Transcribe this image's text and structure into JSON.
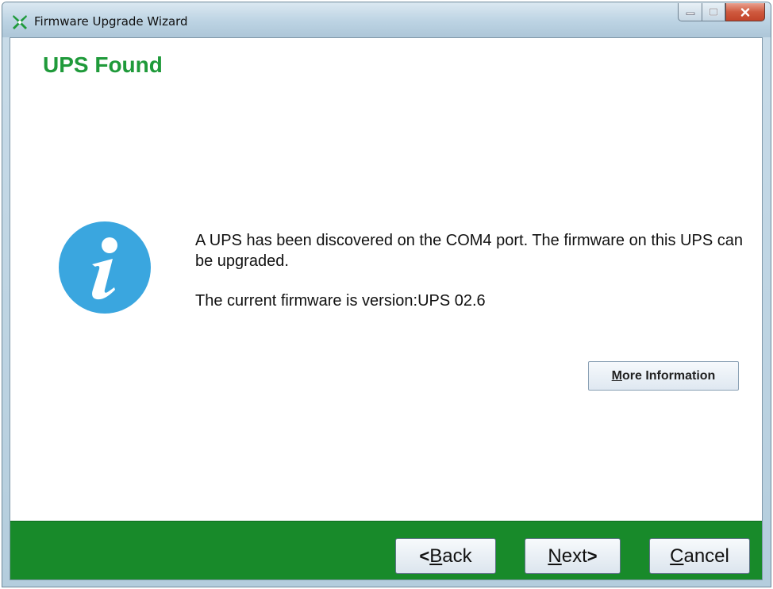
{
  "window": {
    "title": "Firmware Upgrade Wizard",
    "caption_buttons": [
      "minimize-icon",
      "maximize-icon",
      "close-icon"
    ]
  },
  "page": {
    "title": "UPS Found",
    "icon": "info-icon",
    "message_line1": "A UPS has been discovered on the COM4 port. The firmware on this UPS can be upgraded.",
    "message_line2": "The current firmware is version:UPS 02.6",
    "more_info_button": {
      "mnemonic": "M",
      "label_rest": "ore Information"
    }
  },
  "footer": {
    "back_button": {
      "arrow": "<",
      "mnemonic": "B",
      "label_rest": "ack"
    },
    "next_button": {
      "mnemonic": "N",
      "label_rest": "ext",
      "arrow": ">"
    },
    "cancel_button": {
      "mnemonic": "C",
      "label_rest": "ancel"
    }
  },
  "colors": {
    "accent_green": "#1f9a3a",
    "footer_green": "#188a2a",
    "info_blue": "#3aa6df"
  }
}
